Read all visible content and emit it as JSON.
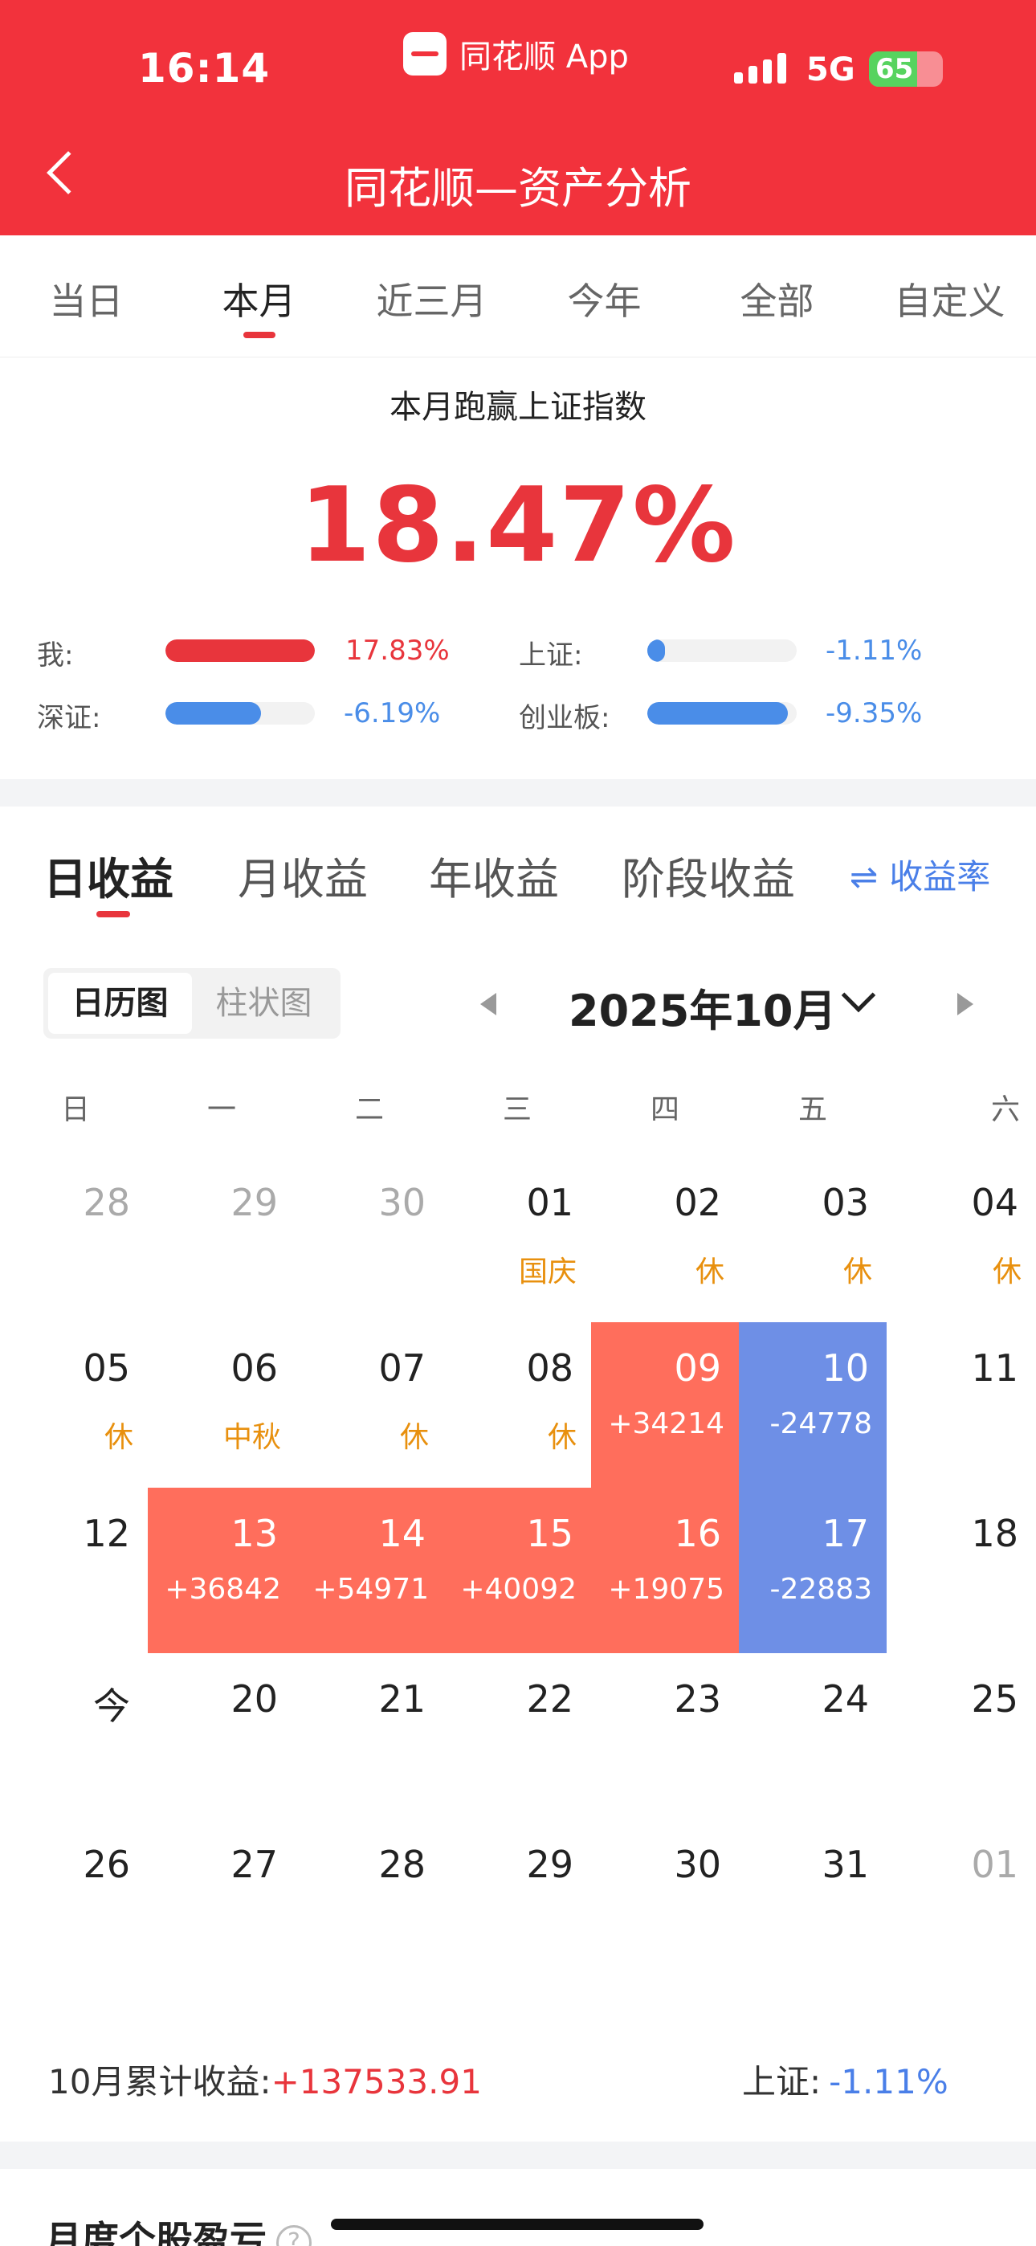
{
  "status": {
    "time": "16:14",
    "app": "同花顺 App",
    "network": "5G",
    "battery": "65"
  },
  "header": {
    "title": "同花顺—资产分析"
  },
  "period_tabs": [
    "当日",
    "本月",
    "近三月",
    "今年",
    "全部",
    "自定义"
  ],
  "summary": {
    "title": "本月跑赢上证指数",
    "value": "18.47%",
    "comparisons": [
      {
        "label": "我:",
        "pct": "17.83%",
        "fill": 1.0,
        "color": "#e8353c"
      },
      {
        "label": "上证:",
        "pct": "-1.11%",
        "fill": 0.12,
        "color": "#4a8de8"
      },
      {
        "label": "深证:",
        "pct": "-6.19%",
        "fill": 0.64,
        "color": "#4a8de8"
      },
      {
        "label": "创业板:",
        "pct": "-9.35%",
        "fill": 0.94,
        "color": "#4a8de8"
      }
    ]
  },
  "earnings_tabs": [
    "日收益",
    "月收益",
    "年收益",
    "阶段收益"
  ],
  "rate_toggle": {
    "icon": "swap-icon",
    "label": "收益率"
  },
  "view_switch": [
    "日历图",
    "柱状图"
  ],
  "month_label": "2025年10月",
  "weekdays": [
    "日",
    "一",
    "二",
    "三",
    "四",
    "五",
    "六"
  ],
  "calendar": [
    [
      {
        "d": "28",
        "muted": true
      },
      {
        "d": "29",
        "muted": true
      },
      {
        "d": "30",
        "muted": true
      },
      {
        "d": "01",
        "sub": "国庆"
      },
      {
        "d": "02",
        "sub": "休"
      },
      {
        "d": "03",
        "sub": "休"
      },
      {
        "d": "04",
        "sub": "休"
      }
    ],
    [
      {
        "d": "05",
        "sub": "休"
      },
      {
        "d": "06",
        "sub": "中秋"
      },
      {
        "d": "07",
        "sub": "休"
      },
      {
        "d": "08",
        "sub": "休"
      },
      {
        "d": "09",
        "sub": "+34214",
        "tone": "up"
      },
      {
        "d": "10",
        "sub": "-24778",
        "tone": "down"
      },
      {
        "d": "11"
      }
    ],
    [
      {
        "d": "12"
      },
      {
        "d": "13",
        "sub": "+36842",
        "tone": "up"
      },
      {
        "d": "14",
        "sub": "+54971",
        "tone": "up"
      },
      {
        "d": "15",
        "sub": "+40092",
        "tone": "up"
      },
      {
        "d": "16",
        "sub": "+19075",
        "tone": "up"
      },
      {
        "d": "17",
        "sub": "-22883",
        "tone": "down"
      },
      {
        "d": "18"
      }
    ],
    [
      {
        "d": "今"
      },
      {
        "d": "20"
      },
      {
        "d": "21"
      },
      {
        "d": "22"
      },
      {
        "d": "23"
      },
      {
        "d": "24"
      },
      {
        "d": "25"
      }
    ],
    [
      {
        "d": "26"
      },
      {
        "d": "27"
      },
      {
        "d": "28"
      },
      {
        "d": "29"
      },
      {
        "d": "30"
      },
      {
        "d": "31"
      },
      {
        "d": "01",
        "muted": true
      }
    ]
  ],
  "totals": {
    "label": "10月累计收益:",
    "value": "+137533.91",
    "sh_label": "上证:",
    "sh_value": "-1.11%"
  },
  "bottom_section": {
    "title": "月度个股盈亏",
    "help_icon": "?"
  }
}
